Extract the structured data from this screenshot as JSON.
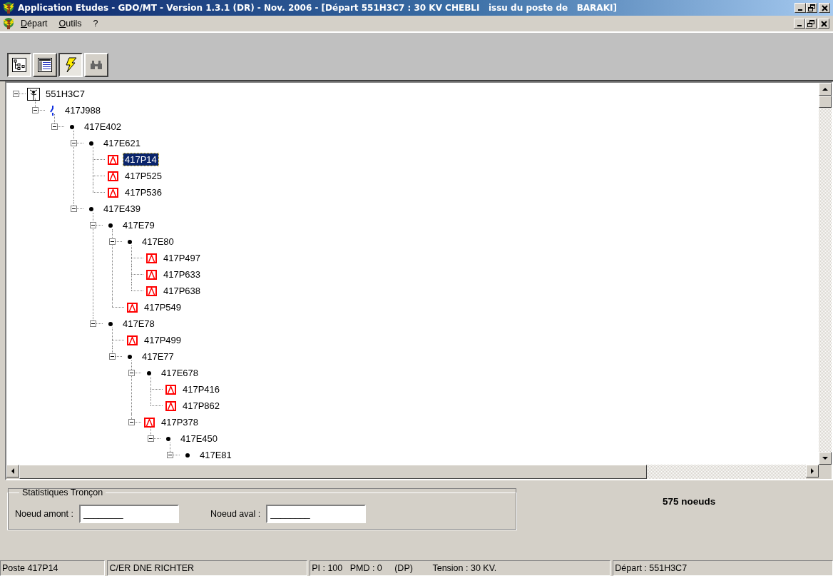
{
  "window": {
    "title": "Application Etudes - GDO/MT - Version 1.3.1 (DR) - Nov. 2006 - [Départ 551H3C7 : 30 KV CHEBLI   issu du poste de   BARAKI]"
  },
  "menu": [
    {
      "label": "Départ"
    },
    {
      "label": "Outils"
    },
    {
      "label": "?"
    }
  ],
  "toolbar": [
    {
      "kind": "tree",
      "pressed": true
    },
    {
      "kind": "list",
      "pressed": false
    },
    {
      "kind": "lightning",
      "pressed": true
    },
    {
      "kind": "binoculars",
      "pressed": false
    }
  ],
  "tree": [
    {
      "kind": "source",
      "label": "551H3C7",
      "expanded": true,
      "selected": false,
      "children": [
        {
          "kind": "switch",
          "label": "417J988",
          "expanded": true,
          "selected": false,
          "children": [
            {
              "kind": "node",
              "label": "417E402",
              "expanded": true,
              "selected": false,
              "children": [
                {
                  "kind": "node",
                  "label": "417E621",
                  "expanded": true,
                  "selected": false,
                  "children": [
                    {
                      "kind": "post",
                      "label": "417P14",
                      "selected": true
                    },
                    {
                      "kind": "post",
                      "label": "417P525",
                      "selected": false
                    },
                    {
                      "kind": "post",
                      "label": "417P536",
                      "selected": false
                    }
                  ]
                },
                {
                  "kind": "node",
                  "label": "417E439",
                  "expanded": true,
                  "selected": false,
                  "children": [
                    {
                      "kind": "node",
                      "label": "417E79",
                      "expanded": true,
                      "selected": false,
                      "children": [
                        {
                          "kind": "node",
                          "label": "417E80",
                          "expanded": true,
                          "selected": false,
                          "children": [
                            {
                              "kind": "post",
                              "label": "417P497",
                              "selected": false
                            },
                            {
                              "kind": "post",
                              "label": "417P633",
                              "selected": false
                            },
                            {
                              "kind": "post",
                              "label": "417P638",
                              "selected": false
                            }
                          ]
                        },
                        {
                          "kind": "post",
                          "label": "417P549",
                          "selected": false
                        }
                      ]
                    },
                    {
                      "kind": "node",
                      "label": "417E78",
                      "expanded": true,
                      "selected": false,
                      "children": [
                        {
                          "kind": "post",
                          "label": "417P499",
                          "selected": false
                        },
                        {
                          "kind": "node",
                          "label": "417E77",
                          "expanded": true,
                          "selected": false,
                          "children": [
                            {
                              "kind": "node",
                              "label": "417E678",
                              "expanded": true,
                              "selected": false,
                              "children": [
                                {
                                  "kind": "post",
                                  "label": "417P416",
                                  "selected": false
                                },
                                {
                                  "kind": "post",
                                  "label": "417P862",
                                  "selected": false
                                }
                              ]
                            },
                            {
                              "kind": "post",
                              "label": "417P378",
                              "expanded": true,
                              "selected": false,
                              "children": [
                                {
                                  "kind": "node",
                                  "label": "417E450",
                                  "expanded": true,
                                  "selected": false,
                                  "children": [
                                    {
                                      "kind": "node",
                                      "label": "417E81",
                                      "expanded": true,
                                      "selected": false
                                    }
                                  ]
                                }
                              ]
                            }
                          ]
                        }
                      ]
                    }
                  ]
                }
              ]
            }
          ]
        }
      ]
    }
  ],
  "stats": {
    "title": "Statistiques Tronçon",
    "upstream_label": "Noeud amont :",
    "upstream_value": "________",
    "downstream_label": "Noeud aval :",
    "downstream_value": "________",
    "count": "575 noeuds"
  },
  "status_bar": [
    "Poste 417P14",
    "C/ER DNE RICHTER",
    "PI : 100   PMD : 0     (DP)        Tension : 30 KV.",
    "Départ : 551H3C7"
  ]
}
